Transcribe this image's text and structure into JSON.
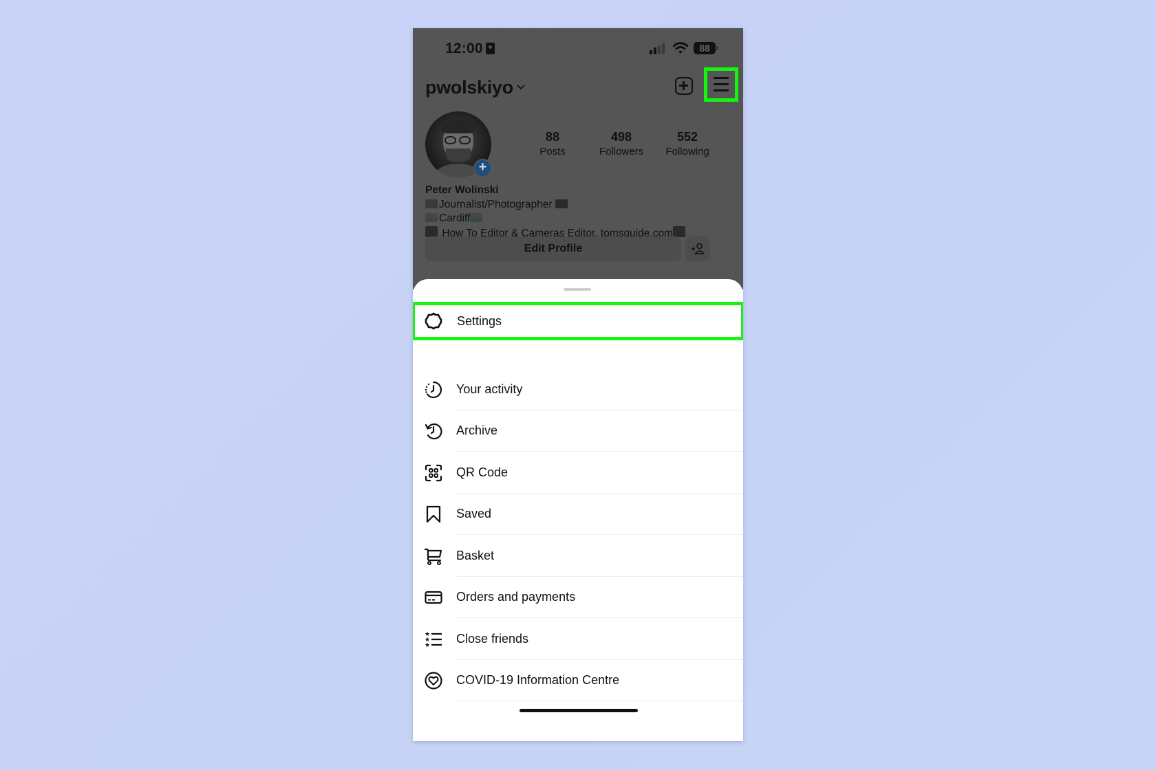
{
  "status_bar": {
    "time": "12:00",
    "battery": "88",
    "icons": [
      "focus-icon",
      "cellular-signal-icon",
      "wifi-icon",
      "battery-icon"
    ]
  },
  "header": {
    "username": "pwolskiyo",
    "dropdown_icon": "chevron-down-icon",
    "new_post_icon": "plus-square-icon",
    "menu_icon": "hamburger-menu-icon"
  },
  "profile": {
    "stats": [
      {
        "value": "88",
        "label": "Posts"
      },
      {
        "value": "498",
        "label": "Followers"
      },
      {
        "value": "552",
        "label": "Following"
      }
    ],
    "name": "Peter Wolinski",
    "bio_lines": [
      "Journalist/Photographer",
      "Cardiff",
      "How To Editor & Cameras Editor, tomsguide.com"
    ],
    "edit_profile_label": "Edit Profile",
    "discover_people_icon": "add-person-icon"
  },
  "menu": {
    "items": [
      {
        "label": "Settings",
        "icon": "settings-icon"
      },
      {
        "label": "Your activity",
        "icon": "activity-icon"
      },
      {
        "label": "Archive",
        "icon": "archive-icon"
      },
      {
        "label": "QR Code",
        "icon": "qr-code-icon"
      },
      {
        "label": "Saved",
        "icon": "bookmark-icon"
      },
      {
        "label": "Basket",
        "icon": "cart-icon"
      },
      {
        "label": "Orders and payments",
        "icon": "card-icon"
      },
      {
        "label": "Close friends",
        "icon": "close-friends-list-icon"
      },
      {
        "label": "COVID-19 Information Centre",
        "icon": "covid-heart-icon"
      }
    ]
  },
  "highlights": {
    "color": "#16f50f",
    "targets": [
      "hamburger-menu-button",
      "menu-item-settings"
    ]
  },
  "colors": {
    "background": "#c9d4f7",
    "dim_overlay": "#555555",
    "sheet": "#ffffff",
    "text": "#111111"
  }
}
